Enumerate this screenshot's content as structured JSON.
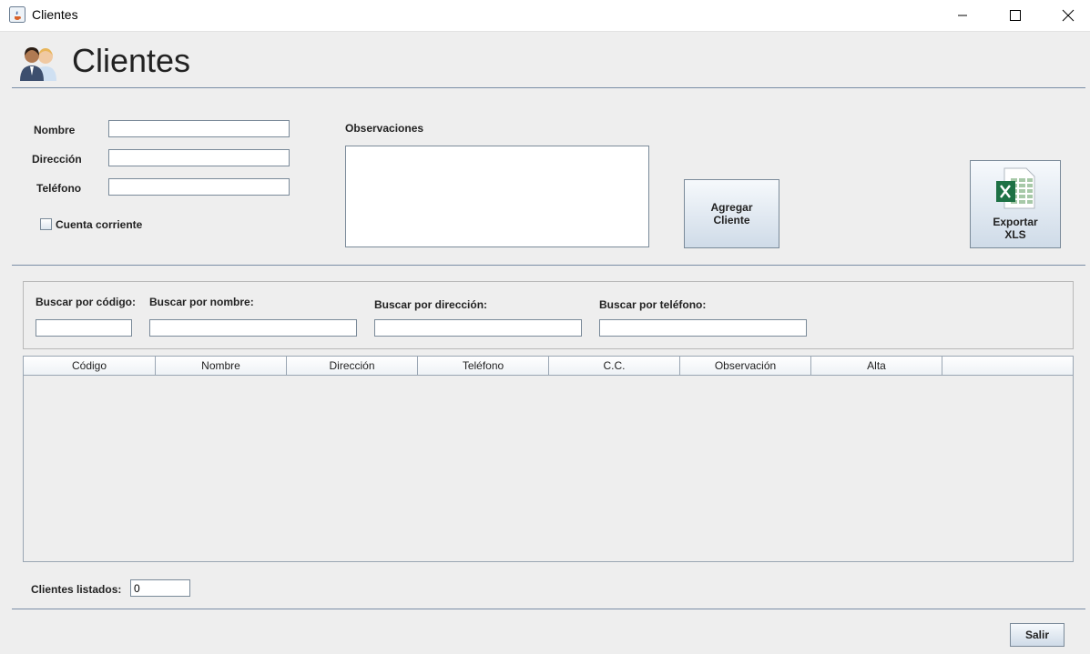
{
  "window": {
    "title": "Clientes"
  },
  "header": {
    "title": "Clientes",
    "icon": "clients-icon"
  },
  "form": {
    "nombre_label": "Nombre",
    "direccion_label": "Dirección",
    "telefono_label": "Teléfono",
    "cuenta_corriente_label": "Cuenta corriente",
    "observaciones_label": "Observaciones",
    "nombre_value": "",
    "direccion_value": "",
    "telefono_value": "",
    "observaciones_value": ""
  },
  "buttons": {
    "agregar_line1": "Agregar",
    "agregar_line2": "Cliente",
    "exportar_line1": "Exportar",
    "exportar_line2": "XLS",
    "salir": "Salir"
  },
  "search": {
    "codigo_label": "Buscar por código:",
    "nombre_label": "Buscar por nombre:",
    "direccion_label": "Buscar por dirección:",
    "telefono_label": "Buscar por teléfono:"
  },
  "table": {
    "columns": [
      "Código",
      "Nombre",
      "Dirección",
      "Teléfono",
      "C.C.",
      "Observación",
      "Alta"
    ],
    "rows": []
  },
  "footer": {
    "count_label": "Clientes listados:",
    "count_value": "0"
  },
  "colors": {
    "separator": "#7a8ea6",
    "button_gradient_top": "#f6f9fc",
    "button_gradient_bottom": "#cfdbe8",
    "excel_green": "#1e7145"
  }
}
